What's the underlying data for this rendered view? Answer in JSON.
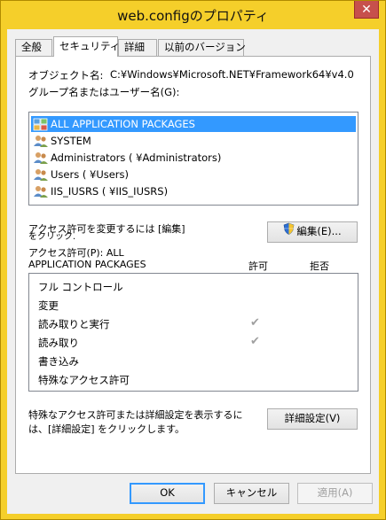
{
  "window": {
    "title": "web.configのプロパティ",
    "close_label": "✕",
    "accent": "#f5cf2a"
  },
  "tabs": [
    {
      "label": "全般",
      "active": false
    },
    {
      "label": "セキュリティ",
      "active": true
    },
    {
      "label": "詳細",
      "active": false
    },
    {
      "label": "以前のバージョン",
      "active": false
    }
  ],
  "security": {
    "object_name_label": "オブジェクト名:",
    "object_name_value": "C:¥Windows¥Microsoft.NET¥Framework64¥v4.0",
    "groups_label": "グループ名またはユーザー名(G):",
    "principals": [
      {
        "name": "ALL APPLICATION PACKAGES",
        "icon": "app-packages-icon",
        "selected": true
      },
      {
        "name": "SYSTEM",
        "icon": "user-group-icon",
        "selected": false
      },
      {
        "name": "Administrators (          ¥Administrators)",
        "icon": "user-group-icon",
        "selected": false
      },
      {
        "name": "Users (          ¥Users)",
        "icon": "user-group-icon",
        "selected": false
      },
      {
        "name": "IIS_IUSRS (          ¥IIS_IUSRS)",
        "icon": "user-group-icon",
        "selected": false
      }
    ],
    "change_perm_text_1": "アクセス許可を変更するには [編集]",
    "change_perm_text_2": "をクリック.",
    "edit_button": "編集(E)...",
    "perm_for_line1": "アクセス許可(P): ALL",
    "perm_for_line2": "APPLICATION PACKAGES",
    "allow_header": "許可",
    "deny_header": "拒否",
    "permissions": [
      {
        "name": "フル コントロール",
        "allow": false,
        "deny": false
      },
      {
        "name": "変更",
        "allow": false,
        "deny": false
      },
      {
        "name": "読み取りと実行",
        "allow": true,
        "deny": false
      },
      {
        "name": "読み取り",
        "allow": true,
        "deny": false
      },
      {
        "name": "書き込み",
        "allow": false,
        "deny": false
      },
      {
        "name": "特殊なアクセス許可",
        "allow": false,
        "deny": false
      }
    ],
    "advanced_text_1": "特殊なアクセス許可または詳細設定を表示するに",
    "advanced_text_2": "は、[詳細設定] をクリックします。",
    "advanced_button": "詳細設定(V)"
  },
  "footer": {
    "ok": "OK",
    "cancel": "キャンセル",
    "apply": "適用(A)"
  }
}
